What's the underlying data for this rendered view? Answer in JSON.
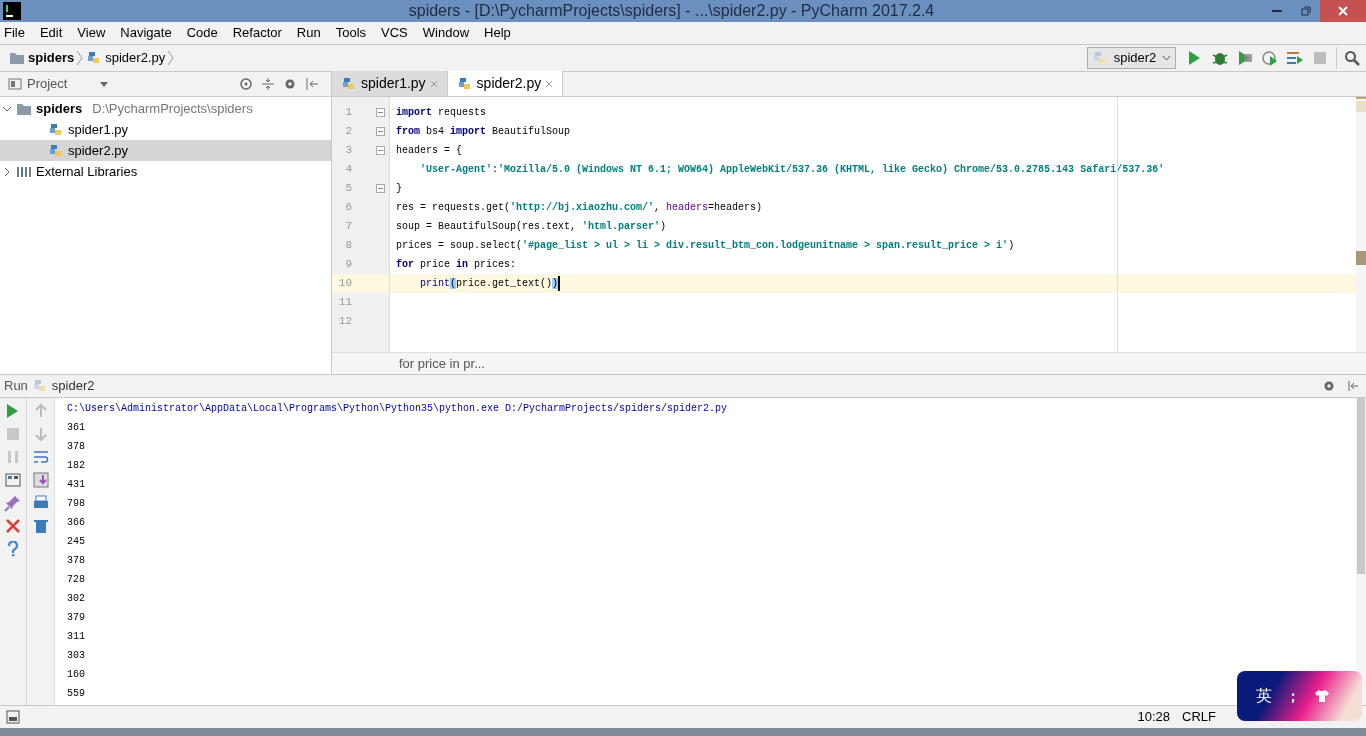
{
  "window": {
    "title": "spiders - [D:\\PycharmProjects\\spiders] - ...\\spider2.py - PyCharm 2017.2.4"
  },
  "menu": [
    "File",
    "Edit",
    "View",
    "Navigate",
    "Code",
    "Refactor",
    "Run",
    "Tools",
    "VCS",
    "Window",
    "Help"
  ],
  "navbar": {
    "breadcrumbs": [
      {
        "label": "spiders",
        "kind": "folder"
      },
      {
        "label": "spider2.py",
        "kind": "python"
      }
    ],
    "run_config": "spider2"
  },
  "project_panel": {
    "title": "Project",
    "tree": [
      {
        "label": "spiders",
        "path": "D:\\PycharmProjects\\spiders",
        "kind": "folder",
        "expanded": true,
        "selected": false,
        "children": [
          {
            "label": "spider1.py",
            "kind": "python",
            "selected": false
          },
          {
            "label": "spider2.py",
            "kind": "python",
            "selected": true
          }
        ]
      },
      {
        "label": "External Libraries",
        "kind": "library",
        "expanded": false,
        "selected": false
      }
    ]
  },
  "editor": {
    "tabs": [
      {
        "label": "spider1.py",
        "selected": false
      },
      {
        "label": "spider2.py",
        "selected": true
      }
    ],
    "lines": [
      {
        "number": "1",
        "fold": true,
        "current": false,
        "tokens": [
          {
            "kind": "keyword",
            "text": "import"
          },
          {
            "kind": "plain",
            "text": " requests"
          }
        ]
      },
      {
        "number": "2",
        "fold": true,
        "current": false,
        "tokens": [
          {
            "kind": "keyword",
            "text": "from"
          },
          {
            "kind": "plain",
            "text": " bs4 "
          },
          {
            "kind": "keyword",
            "text": "import"
          },
          {
            "kind": "plain",
            "text": " BeautifulSoup"
          }
        ]
      },
      {
        "number": "3",
        "fold": true,
        "current": false,
        "tokens": [
          {
            "kind": "plain",
            "text": "headers = {"
          }
        ]
      },
      {
        "number": "4",
        "fold": false,
        "current": false,
        "tokens": [
          {
            "kind": "string",
            "text": "    'User-Agent'"
          },
          {
            "kind": "plain",
            "text": ":"
          },
          {
            "kind": "string",
            "text": "'Mozilla/5.0 (Windows NT 6.1; WOW64) AppleWebKit/537.36 (KHTML, like Gecko) Chrome/53.0.2785.143 Safari/537.36'"
          }
        ]
      },
      {
        "number": "5",
        "fold": true,
        "current": false,
        "tokens": [
          {
            "kind": "plain",
            "text": "}"
          }
        ]
      },
      {
        "number": "6",
        "fold": false,
        "current": false,
        "tokens": [
          {
            "kind": "plain",
            "text": "res = requests.get("
          },
          {
            "kind": "string",
            "text": "'http://bj.xiaozhu.com/'"
          },
          {
            "kind": "plain",
            "text": ", "
          },
          {
            "kind": "param",
            "text": "headers"
          },
          {
            "kind": "plain",
            "text": "=headers)"
          }
        ]
      },
      {
        "number": "7",
        "fold": false,
        "current": false,
        "tokens": [
          {
            "kind": "plain",
            "text": "soup = BeautifulSoup(res.text, "
          },
          {
            "kind": "string",
            "text": "'html.parser'"
          },
          {
            "kind": "plain",
            "text": ")"
          }
        ]
      },
      {
        "number": "8",
        "fold": false,
        "current": false,
        "tokens": [
          {
            "kind": "plain",
            "text": "prices = soup.select("
          },
          {
            "kind": "string",
            "text": "'#page_list > ul > li > div.result_btm_con.lodgeunitname > span.result_price > i'"
          },
          {
            "kind": "plain",
            "text": ")"
          }
        ]
      },
      {
        "number": "9",
        "fold": false,
        "current": false,
        "tokens": [
          {
            "kind": "keyword",
            "text": "for"
          },
          {
            "kind": "plain",
            "text": " price "
          },
          {
            "kind": "keyword",
            "text": "in"
          },
          {
            "kind": "plain",
            "text": " prices:"
          }
        ]
      },
      {
        "number": "10",
        "fold": false,
        "current": true,
        "tokens": [
          {
            "kind": "builtin",
            "text": "    print"
          },
          {
            "kind": "brace",
            "text": "("
          },
          {
            "kind": "plain",
            "text": "price.get_text()"
          },
          {
            "kind": "brace",
            "text": ")"
          }
        ]
      },
      {
        "number": "11",
        "fold": false,
        "current": false
      },
      {
        "number": "12",
        "fold": false,
        "current": false
      }
    ],
    "breadcrumb": "for price in pr..."
  },
  "run_panel": {
    "title": "Run",
    "config": "spider2",
    "output": [
      {
        "kind": "command",
        "text": "C:\\Users\\Administrator\\AppData\\Local\\Programs\\Python\\Python35\\python.exe D:/PycharmProjects/spiders/spider2.py"
      },
      {
        "kind": "stdout",
        "text": "361"
      },
      {
        "kind": "stdout",
        "text": "378"
      },
      {
        "kind": "stdout",
        "text": "182"
      },
      {
        "kind": "stdout",
        "text": "431"
      },
      {
        "kind": "stdout",
        "text": "798"
      },
      {
        "kind": "stdout",
        "text": "366"
      },
      {
        "kind": "stdout",
        "text": "245"
      },
      {
        "kind": "stdout",
        "text": "378"
      },
      {
        "kind": "stdout",
        "text": "728"
      },
      {
        "kind": "stdout",
        "text": "302"
      },
      {
        "kind": "stdout",
        "text": "379"
      },
      {
        "kind": "stdout",
        "text": "311"
      },
      {
        "kind": "stdout",
        "text": "303"
      },
      {
        "kind": "stdout",
        "text": "160"
      },
      {
        "kind": "stdout",
        "text": "559"
      }
    ]
  },
  "status_bar": {
    "position": "10:28",
    "line_separator": "CRLF"
  },
  "ime_popup": {
    "mode": "英",
    "punctuation": "；"
  }
}
